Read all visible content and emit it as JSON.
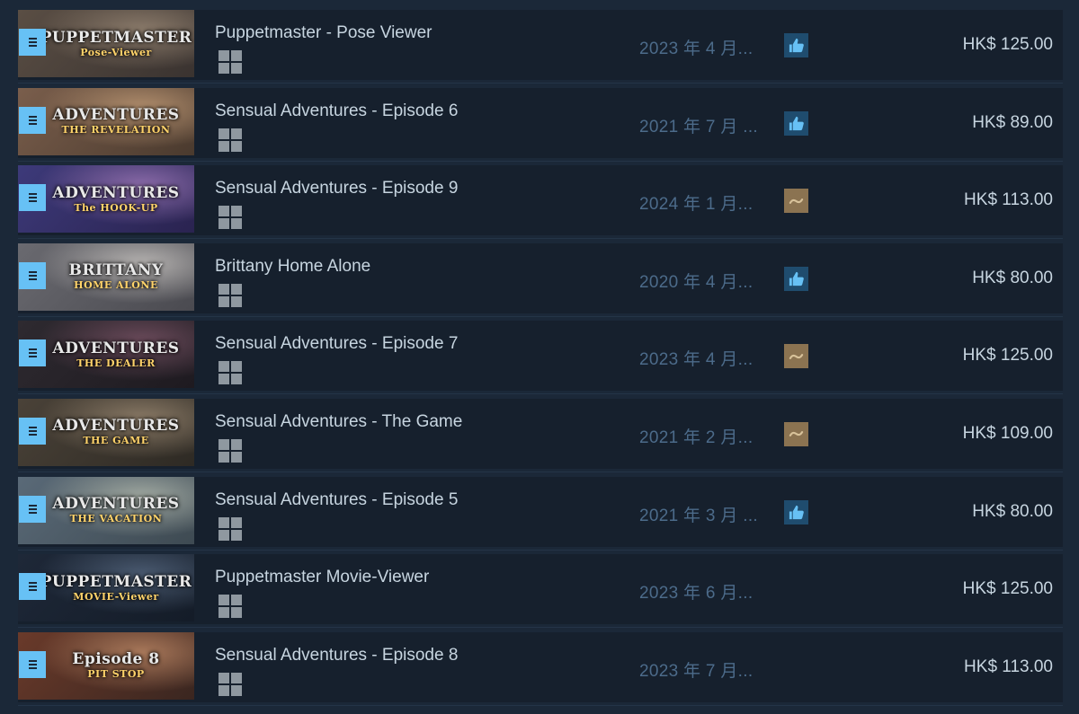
{
  "games": [
    {
      "capsule": {
        "line1": "PUPPETMASTER",
        "line2": "Pose-Viewer",
        "colors": [
          "#5a4e44",
          "#8a7a6a",
          "#3a3330"
        ]
      },
      "title": "Puppetmaster - Pose Viewer",
      "date": "2023 年 4 月...",
      "review": "positive",
      "price": "HK$ 125.00"
    },
    {
      "capsule": {
        "line1": "ADVENTURES",
        "line2": "THE REVELATION",
        "colors": [
          "#7a5e4c",
          "#b08d6c",
          "#4a3a2e"
        ]
      },
      "title": "Sensual Adventures - Episode 6",
      "date": "2021 年 7 月 ...",
      "review": "positive",
      "price": "HK$ 89.00"
    },
    {
      "capsule": {
        "line1": "ADVENTURES",
        "line2": "The HOOK-UP",
        "colors": [
          "#3d3a7a",
          "#8a6aa8",
          "#2a2350"
        ]
      },
      "title": "Sensual Adventures - Episode 9",
      "date": "2024 年 1 月...",
      "review": "mixed",
      "price": "HK$ 113.00"
    },
    {
      "capsule": {
        "line1": "BRITTANY",
        "line2": "HOME ALONE",
        "colors": [
          "#6a6a70",
          "#b5b2b0",
          "#4a4a50"
        ]
      },
      "title": "Brittany Home Alone",
      "date": "2020 年 4 月...",
      "review": "positive",
      "price": "HK$ 80.00"
    },
    {
      "capsule": {
        "line1": "ADVENTURES",
        "line2": "THE DEALER",
        "colors": [
          "#2e2a30",
          "#6a4a5a",
          "#1e1a20"
        ]
      },
      "title": "Sensual Adventures - Episode 7",
      "date": "2023 年 4 月...",
      "review": "mixed",
      "price": "HK$ 125.00"
    },
    {
      "capsule": {
        "line1": "ADVENTURES",
        "line2": "THE GAME",
        "colors": [
          "#4a4238",
          "#8a7a66",
          "#2e2a24"
        ]
      },
      "title": "Sensual Adventures - The Game",
      "date": "2021 年 2 月...",
      "review": "mixed",
      "price": "HK$ 109.00"
    },
    {
      "capsule": {
        "line1": "ADVENTURES",
        "line2": "THE VACATION",
        "colors": [
          "#5a6a78",
          "#a0a8a0",
          "#3e4a52"
        ]
      },
      "title": "Sensual Adventures - Episode 5",
      "date": "2021 年 3 月 ...",
      "review": "positive",
      "price": "HK$ 80.00"
    },
    {
      "capsule": {
        "line1": "PUPPETMASTER",
        "line2": "MOVIE-Viewer",
        "colors": [
          "#1e2838",
          "#4a5a70",
          "#141c28"
        ]
      },
      "title": "Puppetmaster Movie-Viewer",
      "date": "2023 年 6 月...",
      "review": "none",
      "price": "HK$ 125.00"
    },
    {
      "capsule": {
        "line1": "Episode 8",
        "line2": "PIT STOP",
        "colors": [
          "#6a3a2a",
          "#a8785a",
          "#3a2620"
        ]
      },
      "title": "Sensual Adventures - Episode 8",
      "date": "2023 年 7 月...",
      "review": "none",
      "price": "HK$ 113.00"
    }
  ],
  "icons": {
    "menu": "hamburger-menu-icon",
    "platform": "windows-icon",
    "positive_review": "thumbs-up-icon",
    "mixed_review": "tilde-icon"
  },
  "colors": {
    "background": "#1b2838",
    "row": "#16202d",
    "accent": "#67c1f5",
    "positive": "#1f4c6e",
    "mixed": "#8b7351",
    "date_text": "#4c6b8a",
    "title_text": "#c7d5e0"
  }
}
